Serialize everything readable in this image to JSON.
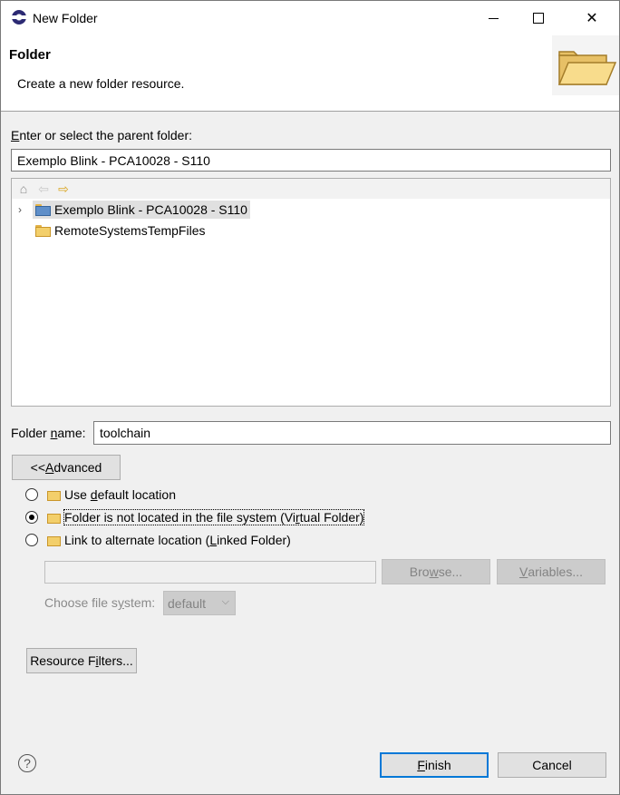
{
  "window": {
    "title": "New Folder",
    "close_glyph": "✕"
  },
  "header": {
    "title": "Folder",
    "description": "Create a new folder resource."
  },
  "parent": {
    "label_pre": "E",
    "label_rest": "nter or select the parent folder:",
    "value": "Exemplo Blink - PCA10028 - S110"
  },
  "tree": {
    "items": [
      {
        "label": "Exemplo Blink - PCA10028 - S110",
        "selected": true,
        "expandable": true
      },
      {
        "label": "RemoteSystemsTempFiles",
        "selected": false,
        "expandable": false
      }
    ]
  },
  "folder_name": {
    "label_pre": "Folder ",
    "label_u": "n",
    "label_post": "ame:",
    "value": "toolchain"
  },
  "advanced_button": {
    "pre": "<< ",
    "u": "A",
    "post": "dvanced"
  },
  "options": [
    {
      "pre": "Use ",
      "u": "d",
      "post": "efault location",
      "checked": false
    },
    {
      "pre": "Folder is not located in the file system (Vi",
      "u": "r",
      "post": "tual Folder)",
      "checked": true
    },
    {
      "pre": "Link to alternate location (",
      "u": "L",
      "post": "inked Folder)",
      "checked": false
    }
  ],
  "location": {
    "path_value": "",
    "browse": {
      "pre": "Bro",
      "u": "w",
      "post": "se..."
    },
    "variables": {
      "pre": "",
      "u": "V",
      "post": "ariables..."
    },
    "fs_label": {
      "pre": "Choose file s",
      "u": "y",
      "post": "stem:"
    },
    "fs_value": "default"
  },
  "resource_filters": {
    "pre": "Resource F",
    "u": "i",
    "post": "lters..."
  },
  "footer": {
    "help_glyph": "?",
    "finish": {
      "pre": "",
      "u": "F",
      "post": "inish"
    },
    "cancel": "Cancel"
  }
}
